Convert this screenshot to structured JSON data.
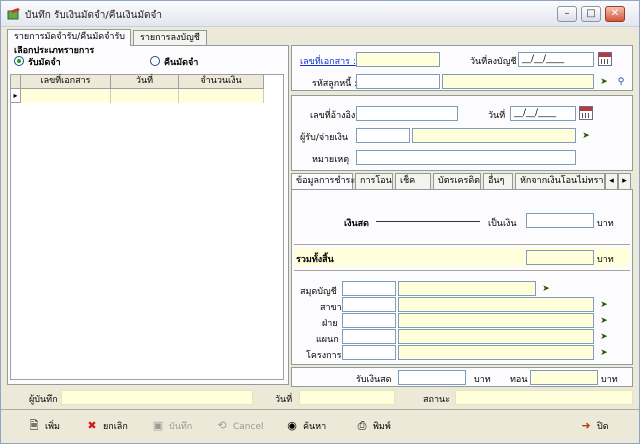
{
  "window": {
    "title": "บันทึก รับเงินมัดจำ/คืนเงินมัดจำ",
    "app_icon": "app-icon",
    "controls": [
      "minimize-icon",
      "maximize-icon",
      "close-icon"
    ]
  },
  "tabs": [
    {
      "label": "รายการมัดจำรับ/คืนมัดจำรับ",
      "active": true
    },
    {
      "label": "รายการลงบัญชี",
      "active": false
    }
  ],
  "left": {
    "section_title": "เลือกประเภทรายการ",
    "radio_receive": "รับมัดจำ",
    "radio_return": "คืนมัดจำ",
    "grid_headers": [
      "เลขที่เอกสาร",
      "วันที่",
      "จำนวนเงิน"
    ]
  },
  "header_form": {
    "doc_no_label": "เลขที่เอกสาร :",
    "post_date_label": "วันที่ลงบัญชี",
    "post_date_value": "__/__/____",
    "debtor_label": "รหัสลูกหนี้ :"
  },
  "ref_form": {
    "ref_no_label": "เลขที่อ้างอิง",
    "date_label": "วันที่",
    "date_value": "__/__/____",
    "payee_label": "ผู้รับ/จ่ายเงิน",
    "remark_label": "หมายเหตุ"
  },
  "payment_tabs": [
    "ข้อมูลการชำระ",
    "การโอน",
    "เช็ค",
    "บัตรเครดิต",
    "อื่นๆ",
    "หักจากเงินโอนไม่ทราบ"
  ],
  "payment": {
    "cash_label": "เงินสด",
    "amount_label": "เป็นเงิน",
    "currency": "บาท",
    "total_label": "รวมทั้งสิ้น",
    "book_label": "สมุดบัญชี",
    "branch_label": "สาขา",
    "division_label": "ฝ่าย",
    "department_label": "แผนก",
    "project_label": "โครงการ"
  },
  "summary": {
    "cash_received_label": "รับเงินสด",
    "change_label": "ทอน",
    "currency": "บาท"
  },
  "status": {
    "recorder_label": "ผู้บันทึก",
    "date_label": "วันที่",
    "state_label": "สถานะ"
  },
  "toolbar": {
    "add": "เพิ่ม",
    "undo": "ยกเลิก",
    "save": "บันทึก",
    "cancel": "Cancel",
    "search": "ค้นหา",
    "print": "พิมพ์",
    "close": "ปิด"
  }
}
